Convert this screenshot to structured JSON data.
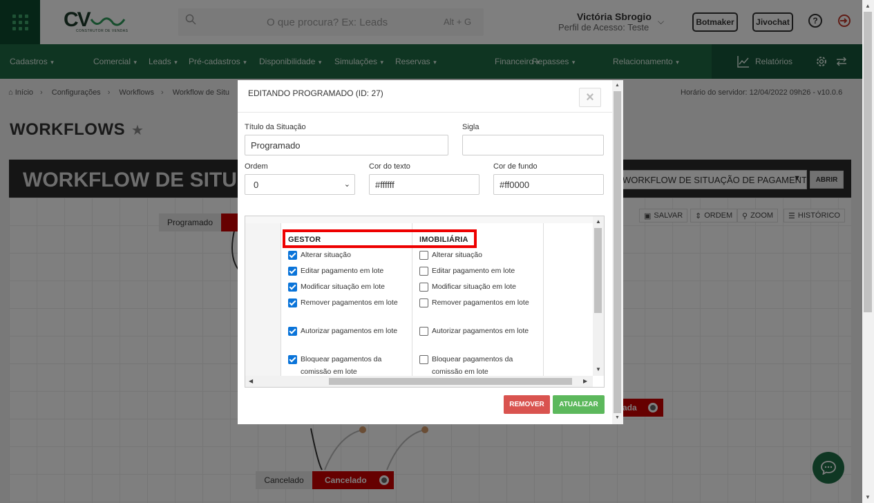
{
  "header": {
    "logo_text": "CV",
    "logo_subtext": "CONSTRUTOR DE VENDAS",
    "search_placeholder": "O que procura? Ex: Leads",
    "search_shortcut": "Alt + G",
    "user_name": "Victória Sbrogio",
    "user_profile": "Perfil de Acesso: Teste",
    "botmaker_label": "Botmaker",
    "jivochat_label": "Jivochat"
  },
  "nav": {
    "items": [
      "Cadastros",
      "Comercial",
      "Leads",
      "Pré-cadastros",
      "Disponibilidade",
      "Simulações",
      "Reservas",
      "Financeiro",
      "Repasses",
      "Relacionamento"
    ],
    "reports": "Relatórios"
  },
  "breadcrumb": [
    "Início",
    "Configurações",
    "Workflows",
    "Workflow de Situ"
  ],
  "server_time": "Horário do servidor: 12/04/2022 09h26 - v10.0.6",
  "page_title": "WORKFLOWS",
  "workflow": {
    "banner_title": "WORKFLOW DE SITUAÇ",
    "select_value": "WORKFLOW DE SITUAÇÃO DE PAGAMENTO",
    "open_button": "ABRIR",
    "tools": [
      "SALVAR",
      "ORDEM",
      "ZOOM",
      "HISTÓRICO"
    ],
    "nodes": {
      "programado_label": "Programado",
      "cancelado_label": "Cancelado",
      "cancelado_box": "Cancelado",
      "partial_box": "ada"
    }
  },
  "modal": {
    "title": "EDITANDO PROGRAMADO (ID: 27)",
    "close_glyph": "×",
    "fields": {
      "titulo_label": "Título da Situação",
      "titulo_value": "Programado",
      "sigla_label": "Sigla",
      "sigla_value": "",
      "ordem_label": "Ordem",
      "ordem_value": "0",
      "cor_texto_label": "Cor do texto",
      "cor_texto_value": "#ffffff",
      "cor_fundo_label": "Cor de fundo",
      "cor_fundo_value": "#ff0000"
    },
    "permissions": {
      "groups": [
        {
          "name": "GESTOR",
          "items": [
            {
              "label": "Alterar situação",
              "checked": true
            },
            {
              "label": "Editar pagamento em lote",
              "checked": true
            },
            {
              "label": "Modificar situação em lote",
              "checked": true
            },
            {
              "label": "Remover pagamentos em lote",
              "checked": true
            },
            {
              "label": "Autorizar pagamentos em lote",
              "checked": true
            },
            {
              "label": "Bloquear pagamentos da comissão em lote",
              "checked": true
            }
          ]
        },
        {
          "name": "IMOBILIÁRIA",
          "items": [
            {
              "label": "Alterar situação",
              "checked": false
            },
            {
              "label": "Editar pagamento em lote",
              "checked": false
            },
            {
              "label": "Modificar situação em lote",
              "checked": false
            },
            {
              "label": "Remover pagamentos em lote",
              "checked": false
            },
            {
              "label": "Autorizar pagamentos em lote",
              "checked": false
            },
            {
              "label": "Bloquear pagamentos da comissão em lote",
              "checked": false
            }
          ]
        }
      ]
    },
    "remove_button": "REMOVER",
    "update_button": "ATUALIZAR"
  },
  "colors": {
    "brand_dark": "#0d4b2f",
    "nav_green": "#1e6b45",
    "checkbox_blue": "#0a74d9",
    "highlight_red": "#e00000",
    "remove_red": "#d9534f",
    "update_green": "#5cb85c"
  }
}
